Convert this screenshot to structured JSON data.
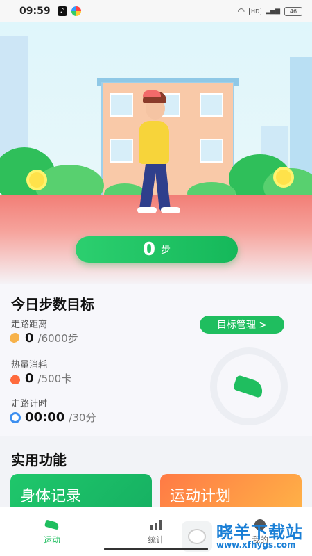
{
  "status_bar": {
    "time": "09:59",
    "network_badge": "HD",
    "battery_level": "46"
  },
  "hero": {
    "step_count": "0",
    "step_unit": "步"
  },
  "goal": {
    "title": "今日步数目标",
    "manage_label": "目标管理 >",
    "metrics": [
      {
        "label": "走路距离",
        "icon": "footprint-icon",
        "value": "0",
        "target": "/6000步"
      },
      {
        "label": "热量消耗",
        "icon": "fire-icon",
        "value": "0",
        "target": "/500卡"
      },
      {
        "label": "走路计时",
        "icon": "clock-icon",
        "value": "00:00",
        "target": "/30分"
      }
    ]
  },
  "functions": {
    "title": "实用功能",
    "cards": [
      {
        "label": "身体记录",
        "color": "#1fc76b"
      },
      {
        "label": "运动计划",
        "color": "#ff8a45"
      }
    ]
  },
  "nav": {
    "items": [
      {
        "label": "运动",
        "icon": "running-shoe-icon",
        "active": true
      },
      {
        "label": "统计",
        "icon": "bar-chart-icon",
        "active": false
      },
      {
        "label": "我的",
        "icon": "user-icon",
        "active": false
      }
    ]
  },
  "watermark": {
    "text": "晓羊下载站",
    "url": "www.xfhygs.com"
  },
  "colors": {
    "accent": "#1fbe5f",
    "hero_ground": "#f27e76"
  }
}
